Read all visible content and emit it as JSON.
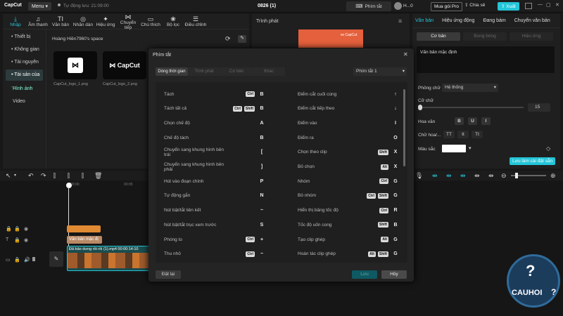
{
  "app": {
    "logo": "CapCut",
    "menu": "Menu",
    "autosave": "Tự động lưu: 21:09:00",
    "project_title": "0826 (1)"
  },
  "topbar": {
    "shortcuts": "Phím tắt",
    "user": "H...0",
    "pro": "Mua gói Pro",
    "share": "Chia sẻ",
    "export": "Xuất"
  },
  "media_tabs": [
    {
      "icon": "import-icon",
      "glyph": "⤓",
      "label": "Nhập"
    },
    {
      "icon": "audio-icon",
      "glyph": "♫",
      "label": "Âm thanh"
    },
    {
      "icon": "text-icon",
      "glyph": "TI",
      "label": "Văn bản"
    },
    {
      "icon": "sticker-icon",
      "glyph": "◎",
      "label": "Nhãn dán"
    },
    {
      "icon": "effects-icon",
      "glyph": "✦",
      "label": "Hiệu ứng"
    },
    {
      "icon": "transition-icon",
      "glyph": "⋈",
      "label": "Chuyển tiếp"
    },
    {
      "icon": "captions-icon",
      "glyph": "▭",
      "label": "Chú thích"
    },
    {
      "icon": "filters-icon",
      "glyph": "❀",
      "label": "Bộ lọc"
    },
    {
      "icon": "adjust-icon",
      "glyph": "☰",
      "label": "Điều chỉnh"
    }
  ],
  "sidebar": {
    "items": [
      "• Thiết bị",
      "• Không gian",
      "• Tài nguyên ...",
      "• Tài sản của ..."
    ],
    "sub": [
      "Hình ảnh",
      "Video"
    ]
  },
  "media": {
    "space": "Hoàng Hiền7960's space",
    "files": [
      "CapCut_logo_1.png",
      "CapCut_logo_2.png"
    ]
  },
  "player": {
    "title": "Trình phát"
  },
  "right_tabs": [
    "Văn bản",
    "Hiệu ứng động",
    "Đang bám",
    "Chuyển văn bản"
  ],
  "right_subtabs": [
    "Cơ bản",
    "Bong bóng",
    "Hiệu ứng"
  ],
  "right": {
    "default_text": "Văn bản mặc định",
    "font_label": "Phông chữ",
    "font_value": "Hệ thống",
    "size_label": "Cỡ chữ",
    "size_value": "15",
    "case_label": "Hoa văn",
    "case_buttons": [
      "B",
      "U",
      "I"
    ],
    "casing_label": "Chữ hoa/...",
    "casing_buttons": [
      "TT",
      "tt",
      "Tt"
    ],
    "color_label": "Màu sắc",
    "save_default": "Lưu làm cài đặt sẵn"
  },
  "dialog": {
    "title": "Phím tắt",
    "tabs": [
      "Dòng thời gian",
      "Trình phát",
      "Cơ bản",
      "Khác"
    ],
    "preset": "Phím tắt 1",
    "reset": "Đặt lại",
    "save": "Lưu",
    "cancel": "Hủy",
    "left": [
      {
        "label": "Tách",
        "mods": [
          "Ctrl"
        ],
        "key": "B"
      },
      {
        "label": "Tách tất cả",
        "mods": [
          "Ctrl",
          "Shift"
        ],
        "key": "B"
      },
      {
        "label": "Chọn chế độ",
        "mods": [],
        "key": "A"
      },
      {
        "label": "Chế độ tách",
        "mods": [],
        "key": "B"
      },
      {
        "label": "Chuyển sang khung hình bên trái",
        "mods": [],
        "key": "["
      },
      {
        "label": "Chuyển sang khung hình bên phải",
        "mods": [],
        "key": "]"
      },
      {
        "label": "Hút vào đoạn chính",
        "mods": [],
        "key": "P"
      },
      {
        "label": "Tự động gắn",
        "mods": [],
        "key": "N"
      },
      {
        "label": "Nút bật/tắt liên kết",
        "mods": [],
        "key": "~"
      },
      {
        "label": "Nút bật/tắt trục xem trước",
        "mods": [],
        "key": "S"
      },
      {
        "label": "Phóng to",
        "mods": [
          "Ctrl"
        ],
        "key": "+"
      },
      {
        "label": "Thu nhỏ",
        "mods": [
          "Ctrl"
        ],
        "key": "−"
      }
    ],
    "right": [
      {
        "label": "Điểm cắt cuối cùng",
        "mods": [],
        "key": "↑"
      },
      {
        "label": "Điểm cắt tiếp theo",
        "mods": [],
        "key": "↓"
      },
      {
        "label": "Điểm vào",
        "mods": [],
        "key": "I"
      },
      {
        "label": "Điểm ra",
        "mods": [],
        "key": "O"
      },
      {
        "label": "Chọn theo clip",
        "mods": [
          "Shift"
        ],
        "key": "X"
      },
      {
        "label": "Bỏ chọn",
        "mods": [
          "Alt"
        ],
        "key": "X"
      },
      {
        "label": "Nhóm",
        "mods": [
          "Ctrl"
        ],
        "key": "G"
      },
      {
        "label": "Bỏ nhóm",
        "mods": [
          "Ctrl",
          "Shift"
        ],
        "key": "G"
      },
      {
        "label": "Hiển thị băng tốc độ",
        "mods": [
          "Ctrl"
        ],
        "key": "R"
      },
      {
        "label": "Tốc độ uốn cong",
        "mods": [
          "Shift"
        ],
        "key": "B"
      },
      {
        "label": "Tạo clip ghép",
        "mods": [
          "Alt"
        ],
        "key": "G"
      },
      {
        "label": "Hoàn tác clip ghép",
        "mods": [
          "Alt",
          "Shift"
        ],
        "key": "G"
      }
    ]
  },
  "timeline": {
    "times": [
      "00:00",
      "00:05"
    ],
    "text_clip": "Văn bản mặc đị",
    "video_clip": "Đã bảo dưng rồi rồi",
    "video_name": "(1).mp4",
    "video_duration": "00:00:14:10"
  },
  "watermark": {
    "text": "CAUHOI",
    "suffix": "?"
  },
  "colors": {
    "accent": "#24c5d8",
    "accent_dark": "#0f6f7a",
    "dialog_bg": "#242424",
    "dialog_row": "#1f1f1f",
    "panel": "#1f1f1f",
    "orange": "#e08a33",
    "track": "#1b4d4e"
  }
}
